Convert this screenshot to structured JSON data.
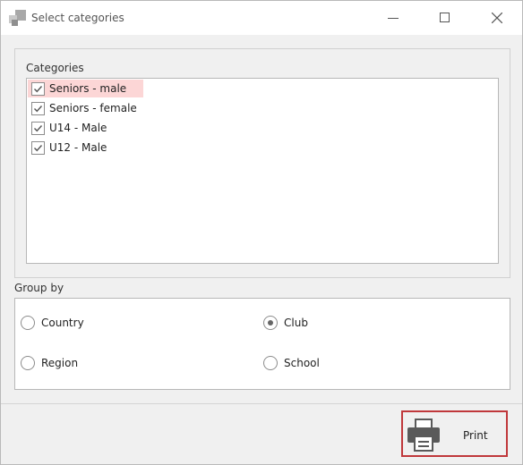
{
  "window": {
    "title": "Select categories"
  },
  "categories": {
    "label": "Categories",
    "items": [
      {
        "label": "Seniors - male",
        "checked": true,
        "selected": true
      },
      {
        "label": "Seniors - female",
        "checked": true,
        "selected": false
      },
      {
        "label": "U14 - Male",
        "checked": true,
        "selected": false
      },
      {
        "label": "U12 - Male",
        "checked": true,
        "selected": false
      }
    ]
  },
  "group_by": {
    "label": "Group by",
    "options": [
      {
        "label": "Country",
        "selected": false
      },
      {
        "label": "Club",
        "selected": true
      },
      {
        "label": "Region",
        "selected": false
      },
      {
        "label": "School",
        "selected": false
      }
    ]
  },
  "footer": {
    "print_label": "Print"
  },
  "colors": {
    "selection_highlight": "#fcd6d6",
    "print_border": "#c0383b",
    "icon_gray": "#5a5a5a"
  },
  "icons": {
    "app": "app-icon",
    "minimize": "minimize-icon",
    "maximize": "maximize-icon",
    "close": "close-icon",
    "print": "printer-icon",
    "checkbox": "checkmark-icon"
  }
}
